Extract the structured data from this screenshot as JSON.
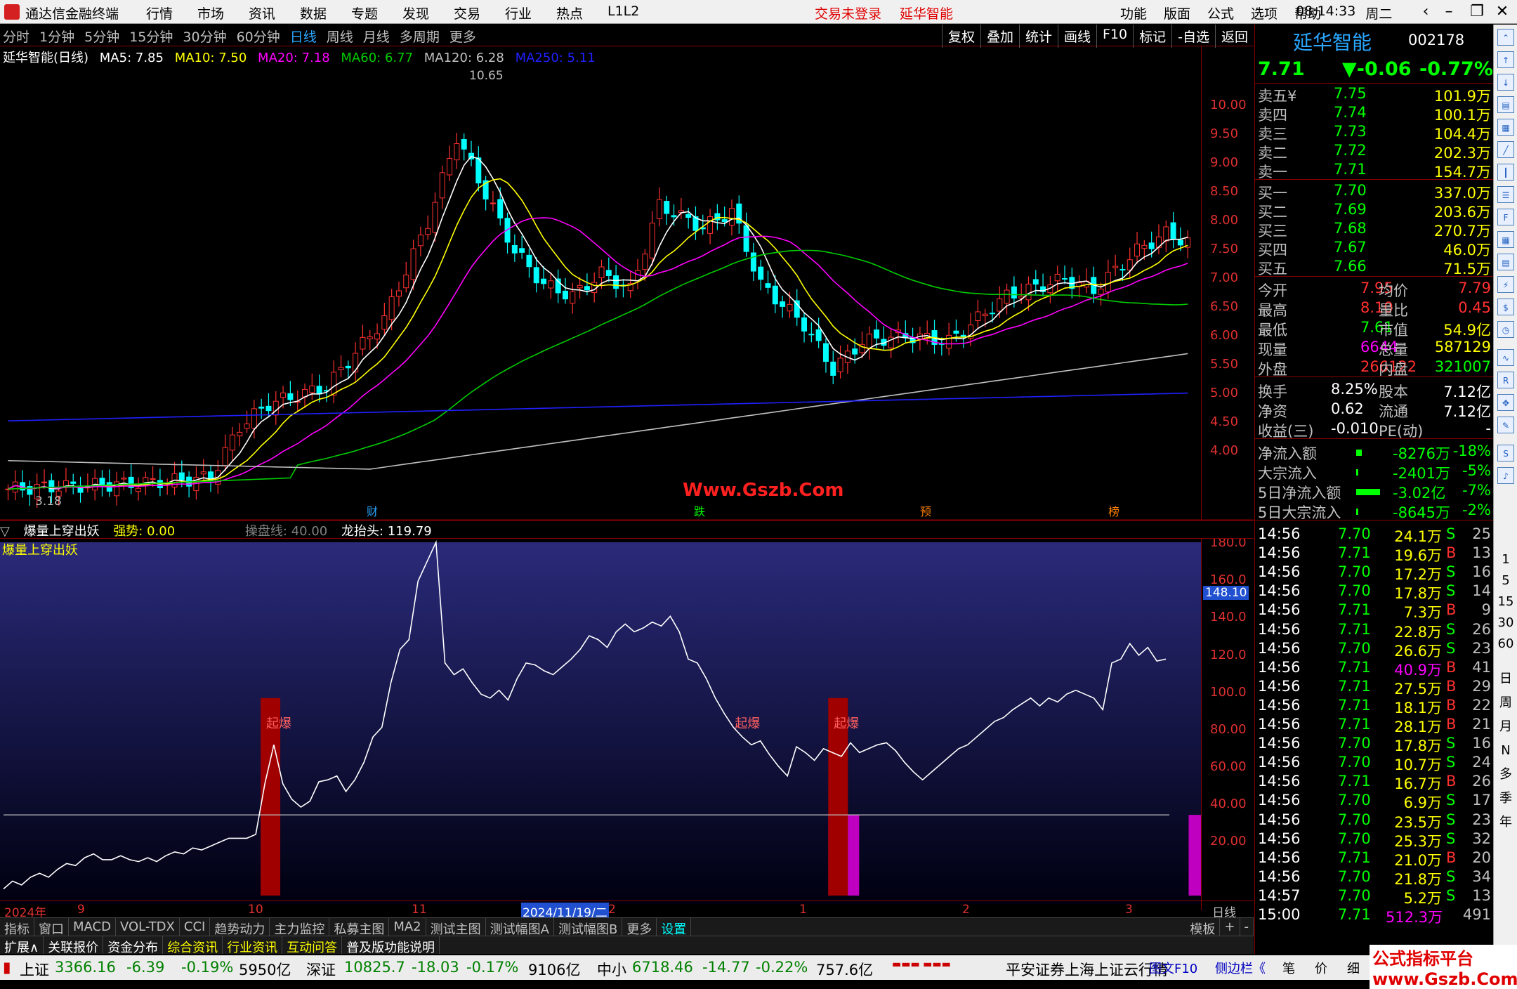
{
  "window": {
    "title": "通达信金融终端",
    "menu": [
      "行情",
      "市场",
      "资讯",
      "数据",
      "专题",
      "发现",
      "交易",
      "行业",
      "热点",
      "L1L2"
    ],
    "center": [
      "交易未登录",
      "延华智能"
    ],
    "right_menu": [
      "功能",
      "版面",
      "公式",
      "选项",
      "帮助"
    ],
    "time": "08:14:33",
    "weekday": "周二"
  },
  "periods": [
    "分时",
    "1分钟",
    "5分钟",
    "15分钟",
    "30分钟",
    "60分钟",
    "日线",
    "周线",
    "月线",
    "多周期",
    "更多"
  ],
  "active_period": "日线",
  "toolbar": [
    "复权",
    "叠加",
    "统计",
    "画线",
    "F10",
    "标记",
    "-自选",
    "返回"
  ],
  "ma_legend": {
    "name": "延华智能(日线)",
    "ma5": "MA5: 7.85",
    "ma10": "MA10: 7.50",
    "ma20": "MA20: 7.18",
    "ma60": "MA60: 6.77",
    "ma120": "MA120: 6.28",
    "ma250": "MA250: 5.11",
    "colors": {
      "ma5": "#ffffff",
      "ma10": "#ffff00",
      "ma20": "#ff00ff",
      "ma60": "#00cc00",
      "ma120": "#c0c0c0",
      "ma250": "#0000ff"
    }
  },
  "main_axis": [
    "10.00",
    "9.50",
    "9.00",
    "8.50",
    "8.00",
    "7.50",
    "7.00",
    "6.50",
    "6.00",
    "5.50",
    "5.00",
    "4.50",
    "4.00"
  ],
  "annotations": {
    "high": "10.65",
    "low": "3.18",
    "site": "Www.Gszb.Com",
    "events": [
      "财",
      "跌",
      "预",
      "榜"
    ]
  },
  "sub": {
    "title": "爆量上穿出妖",
    "strength": "强势: 0.00",
    "line": "操盘线: 40.00",
    "dragon": "龙抬头: 119.79",
    "label": "爆量上穿出妖",
    "marker": "起爆",
    "axis": [
      "180.0",
      "160.0",
      "140.0",
      "120.0",
      "100.0",
      "80.00",
      "60.00",
      "40.00",
      "20.00"
    ],
    "current": "148.10"
  },
  "chart_data": {
    "type": "line",
    "title": "爆量上穿出妖",
    "series": [
      {
        "name": "龙抬头",
        "values": [
          2,
          6,
          4,
          8,
          10,
          8,
          12,
          15,
          14,
          18,
          20,
          17,
          17,
          19,
          17,
          16,
          18,
          16,
          19,
          21,
          20,
          23,
          22,
          24,
          26,
          28,
          28,
          28,
          30,
          56,
          76,
          56,
          48,
          44,
          47,
          57,
          58,
          60,
          52,
          58,
          67,
          80,
          85,
          108,
          125,
          130,
          160,
          170,
          180,
          118,
          112,
          115,
          108,
          102,
          100,
          104,
          99,
          110,
          118,
          117,
          114,
          112,
          116,
          120,
          125,
          132,
          130,
          126,
          134,
          138,
          134,
          136,
          139,
          137,
          142,
          134,
          120,
          118,
          110,
          100,
          92,
          85,
          80,
          76,
          78,
          71,
          65,
          60,
          75,
          72,
          68,
          74,
          72,
          70,
          77,
          72,
          74,
          76,
          77,
          73,
          67,
          62,
          58,
          62,
          66,
          70,
          74,
          76,
          80,
          84,
          88,
          90,
          94,
          97,
          100,
          96,
          100,
          98,
          102,
          104,
          102,
          100,
          94,
          118,
          120,
          128,
          122,
          126,
          119,
          120
        ]
      }
    ],
    "ylim": [
      0,
      180
    ],
    "threshold": 40,
    "signals_red": [
      {
        "start": "2024-09-24",
        "label": "起爆"
      },
      {
        "start": "2024-12-30",
        "label": "起爆"
      },
      {
        "start": "2025-03-05",
        "label": "起爆"
      }
    ],
    "signals_magenta": [
      "2024-12-30",
      "2025-02-18"
    ]
  },
  "dates": {
    "start": "2024年",
    "m9": "9",
    "m10": "10",
    "m11": "11",
    "sel": "2024/11/19/二",
    "m2a": "2",
    "m1": "1",
    "m2b": "2",
    "m3": "3",
    "period": "日线"
  },
  "tabs": [
    "指标",
    "窗口",
    "MACD",
    "VOL-TDX",
    "CCI",
    "趋势动力",
    "主力监控",
    "私募主图",
    "MA2",
    "测试主图",
    "测试幅图A",
    "测试幅图B",
    "更多",
    "设置"
  ],
  "tabs_right": [
    "模板",
    "+",
    "-"
  ],
  "ext": [
    "扩展∧",
    "关联报价",
    "资金分布",
    "综合资讯",
    "行业资讯",
    "互动问答",
    "普及版功能说明"
  ],
  "ext_right": [
    "图文F10",
    "侧边栏《",
    "笔",
    "价",
    "细",
    "势"
  ],
  "quote": {
    "name": "延华智能",
    "code": "002178",
    "price": "7.71",
    "change": "▼-0.06",
    "pct": "-0.77%",
    "asks": [
      [
        "卖五¥",
        "7.75",
        "101.9万"
      ],
      [
        "卖四",
        "7.74",
        "100.1万"
      ],
      [
        "卖三",
        "7.73",
        "104.4万"
      ],
      [
        "卖二",
        "7.72",
        "202.3万"
      ],
      [
        "卖一",
        "7.71",
        "154.7万"
      ]
    ],
    "bids": [
      [
        "买一",
        "7.70",
        "337.0万"
      ],
      [
        "买二",
        "7.69",
        "203.6万"
      ],
      [
        "买三",
        "7.68",
        "270.7万"
      ],
      [
        "买四",
        "7.67",
        "46.0万"
      ],
      [
        "买五",
        "7.66",
        "71.5万"
      ]
    ],
    "stats": [
      [
        "今开",
        "7.95",
        "均价",
        "7.79"
      ],
      [
        "最高",
        "8.10",
        "量比",
        "0.45"
      ],
      [
        "最低",
        "7.61",
        "市值",
        "54.9亿"
      ],
      [
        "现量",
        "6644",
        "总量",
        "587129"
      ],
      [
        "外盘",
        "266122",
        "内盘",
        "321007"
      ]
    ],
    "fund": [
      [
        "换手",
        "8.25%",
        "股本",
        "7.12亿"
      ],
      [
        "净资",
        "0.62",
        "流通",
        "7.12亿"
      ],
      [
        "收益(三)",
        "-0.010",
        "PE(动)",
        "-"
      ]
    ],
    "flows": [
      [
        "净流入额",
        "-8276万",
        "-18%"
      ],
      [
        "大宗流入",
        "-2401万",
        "-5%"
      ],
      [
        "5日净流入额",
        "-3.02亿",
        "-7%"
      ],
      [
        "5日大宗流入",
        "-8645万",
        "-2%"
      ]
    ],
    "ticks": [
      [
        "14:56",
        "7.70",
        "24.1万",
        "S",
        "25"
      ],
      [
        "14:56",
        "7.71",
        "19.6万",
        "B",
        "13"
      ],
      [
        "14:56",
        "7.70",
        "17.2万",
        "S",
        "16"
      ],
      [
        "14:56",
        "7.70",
        "17.8万",
        "S",
        "14"
      ],
      [
        "14:56",
        "7.71",
        "7.3万",
        "B",
        "9"
      ],
      [
        "14:56",
        "7.71",
        "22.8万",
        "S",
        "26"
      ],
      [
        "14:56",
        "7.70",
        "26.6万",
        "S",
        "23"
      ],
      [
        "14:56",
        "7.71",
        "40.9万",
        "B",
        "41"
      ],
      [
        "14:56",
        "7.71",
        "27.5万",
        "B",
        "29"
      ],
      [
        "14:56",
        "7.71",
        "18.1万",
        "B",
        "22"
      ],
      [
        "14:56",
        "7.71",
        "28.1万",
        "B",
        "21"
      ],
      [
        "14:56",
        "7.70",
        "17.8万",
        "S",
        "16"
      ],
      [
        "14:56",
        "7.70",
        "10.7万",
        "S",
        "24"
      ],
      [
        "14:56",
        "7.71",
        "16.7万",
        "B",
        "26"
      ],
      [
        "14:56",
        "7.70",
        "6.9万",
        "S",
        "17"
      ],
      [
        "14:56",
        "7.70",
        "23.5万",
        "S",
        "23"
      ],
      [
        "14:56",
        "7.70",
        "25.3万",
        "S",
        "32"
      ],
      [
        "14:56",
        "7.71",
        "21.0万",
        "B",
        "20"
      ],
      [
        "14:56",
        "7.70",
        "21.8万",
        "S",
        "34"
      ],
      [
        "14:57",
        "7.70",
        "5.2万",
        "S",
        "13"
      ],
      [
        "15:00",
        "7.71",
        "512.3万",
        "",
        "491"
      ]
    ]
  },
  "status": {
    "sh_name": "上证",
    "sh_val": "3366.16",
    "sh_chg": "-6.39",
    "sh_pct": "-0.19%",
    "sh_amt": "5950亿",
    "sz_name": "深证",
    "sz_val": "10825.7",
    "sz_chg": "-18.03",
    "sz_pct": "-0.17%",
    "sz_amt": "9106亿",
    "zx_name": "中小",
    "zx_val": "6718.46",
    "zx_chg": "-14.77",
    "zx_pct": "-0.22%",
    "zx_amt": "757.6亿",
    "broker": "平安证券上海上证云行情"
  },
  "sidebar": [
    "日",
    "周",
    "月",
    "N",
    "多",
    "季",
    "年"
  ],
  "sidebar_nums": [
    "1",
    "5",
    "15",
    "30",
    "60"
  ],
  "watermark": "公式指标平台 www.Gszb.Com"
}
